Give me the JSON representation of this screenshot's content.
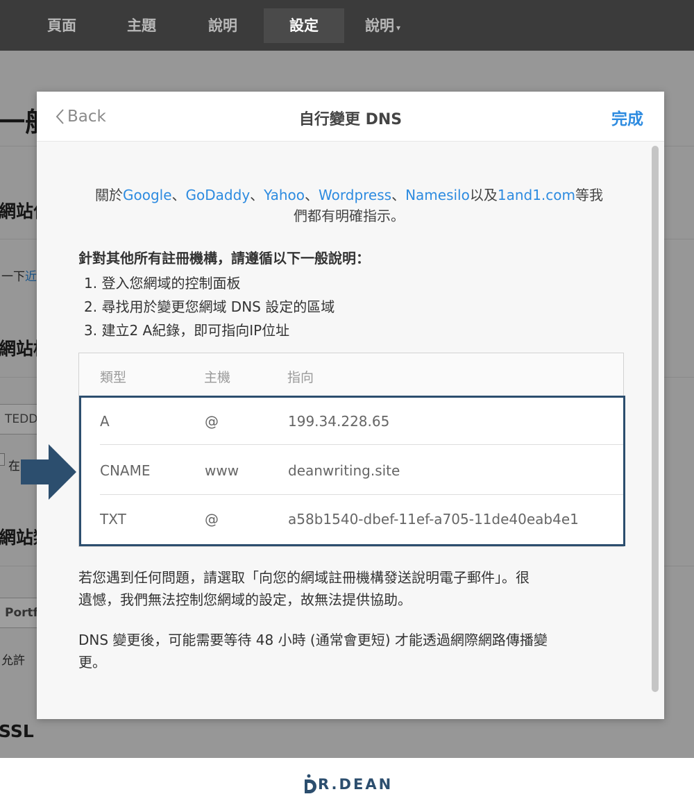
{
  "nav": {
    "items": [
      {
        "label": "頁面",
        "active": false
      },
      {
        "label": "主題",
        "active": false
      },
      {
        "label": "說明",
        "active": false
      },
      {
        "label": "設定",
        "active": true
      },
      {
        "label": "說明",
        "active": false
      }
    ],
    "dropdown_caret": "▾"
  },
  "background": {
    "heading_general": "一般",
    "heading_site_1": "網站位",
    "text_1": "一下",
    "text_1_link": "近",
    "heading_site_2": "網站標",
    "input_1": "TEDD",
    "checkbox_label": "在",
    "heading_site_3": "網站類",
    "input_2": "Portf",
    "text_2": "允許",
    "heading_ssl": "SSL"
  },
  "modal": {
    "back_label": "Back",
    "title": "自行變更 DNS",
    "done_label": "完成",
    "intro": {
      "prefix": "關於",
      "links": [
        "Google",
        "GoDaddy",
        "Yahoo",
        "Wordpress",
        "Namesilo"
      ],
      "separator": "、",
      "between_last": "以及",
      "last_link": "1and1.com",
      "suffix_line1": "等我",
      "line2": "們都有明確指示。"
    },
    "instructions_title": "針對其他所有註冊機構，請遵循以下一般說明：",
    "steps": [
      "1. 登入您網域的控制面板",
      "2. 尋找用於變更您網域 DNS 設定的區域",
      "3. 建立2 A紀錄，即可指向IP位址"
    ],
    "table": {
      "headers": [
        "類型",
        "主機",
        "指向"
      ],
      "rows": [
        {
          "type": "A",
          "host": "@",
          "points_to": "199.34.228.65"
        },
        {
          "type": "CNAME",
          "host": "www",
          "points_to": "deanwriting.site"
        },
        {
          "type": "TXT",
          "host": "@",
          "points_to": "a58b1540-dbef-11ef-a705-11de40eab4e1"
        }
      ]
    },
    "help_text_line1": "若您遇到任何問題，請選取「向您的網域註冊機構發送說明電子郵件」。很",
    "help_text_line2": "遺憾，我們無法控制您網域的設定，故無法提供協助。",
    "propagation_line1": "DNS 變更後，可能需要等待 48 小時 (通常會更短) 才能透過網際網路傳播變",
    "propagation_line2": "更。"
  },
  "colors": {
    "accent": "#2d8be0",
    "highlight_border": "#2c4e6e",
    "nav_bg": "#3b3b3b"
  },
  "footer": {
    "logo_text": "R.DEAN",
    "logo_icon": "d-logo-icon"
  }
}
